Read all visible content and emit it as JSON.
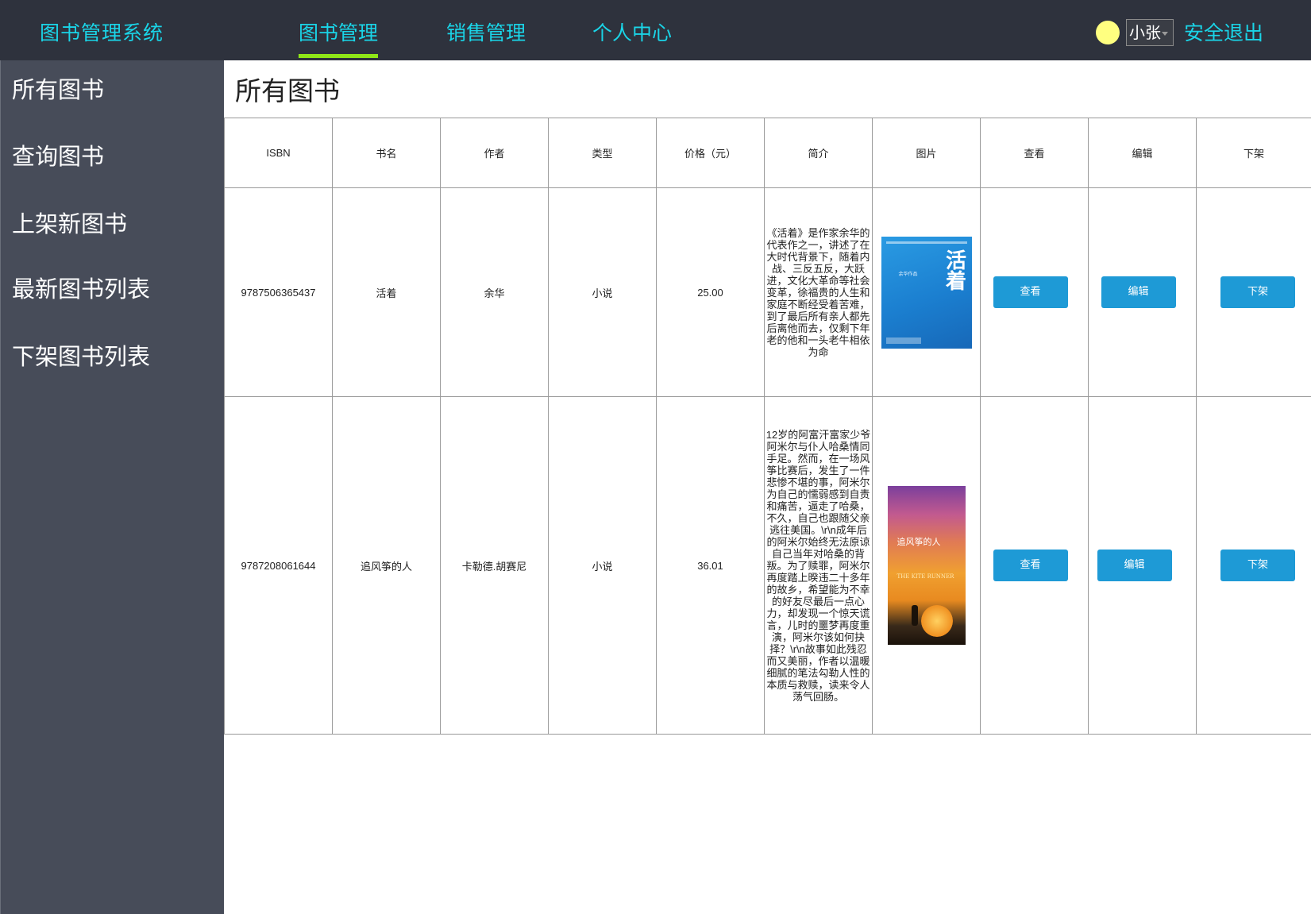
{
  "brand": "图书管理系统",
  "nav": {
    "items": [
      {
        "label": "图书管理",
        "active": true
      },
      {
        "label": "销售管理",
        "active": false
      },
      {
        "label": "个人中心",
        "active": false
      }
    ]
  },
  "user": {
    "name": "小张",
    "logout": "安全退出"
  },
  "sidebar": {
    "items": [
      {
        "label": "所有图书"
      },
      {
        "label": "查询图书"
      },
      {
        "label": "上架新图书"
      },
      {
        "label": "最新图书列表"
      },
      {
        "label": "下架图书列表"
      }
    ]
  },
  "main": {
    "title": "所有图书",
    "headers": [
      "ISBN",
      "书名",
      "作者",
      "类型",
      "价格（元）",
      "简介",
      "图片",
      "查看",
      "编辑",
      "下架"
    ],
    "rows": [
      {
        "isbn": "9787506365437",
        "title": "活着",
        "author": "余华",
        "type": "小说",
        "price": "25.00",
        "desc": "《活着》是作家余华的代表作之一，讲述了在大时代背景下，随着内战、三反五反，大跃进，文化大革命等社会变革，徐福贵的人生和家庭不断经受着苦难，到了最后所有亲人都先后离他而去，仅剩下年老的他和一头老牛相依为命",
        "view": "查看",
        "edit": "编辑",
        "remove": "下架"
      },
      {
        "isbn": "9787208061644",
        "title": "追风筝的人",
        "author": "卡勒德.胡赛尼",
        "type": "小说",
        "price": "36.01",
        "desc": "12岁的阿富汗富家少爷阿米尔与仆人哈桑情同手足。然而，在一场风筝比赛后，发生了一件悲惨不堪的事，阿米尔为自己的懦弱感到自责和痛苦，逼走了哈桑，不久，自己也跟随父亲逃往美国。\\r\\n成年后的阿米尔始终无法原谅自己当年对哈桑的背叛。为了赎罪，阿米尔再度踏上暌违二十多年的故乡，希望能为不幸的好友尽最后一点心力，却发现一个惊天谎言，儿时的噩梦再度重演，阿米尔该如何抉择？\\r\\n故事如此残忍而又美丽，作者以温暖细腻的笔法勾勒人性的本质与救赎，读来令人荡气回肠。",
        "view": "查看",
        "edit": "编辑",
        "remove": "下架"
      }
    ]
  },
  "colors": {
    "topbar": "#2e323d",
    "sidebar": "#474c59",
    "accent_text": "#1ad5e8",
    "active_underline": "#8fe617",
    "button": "#1e9ad6"
  }
}
